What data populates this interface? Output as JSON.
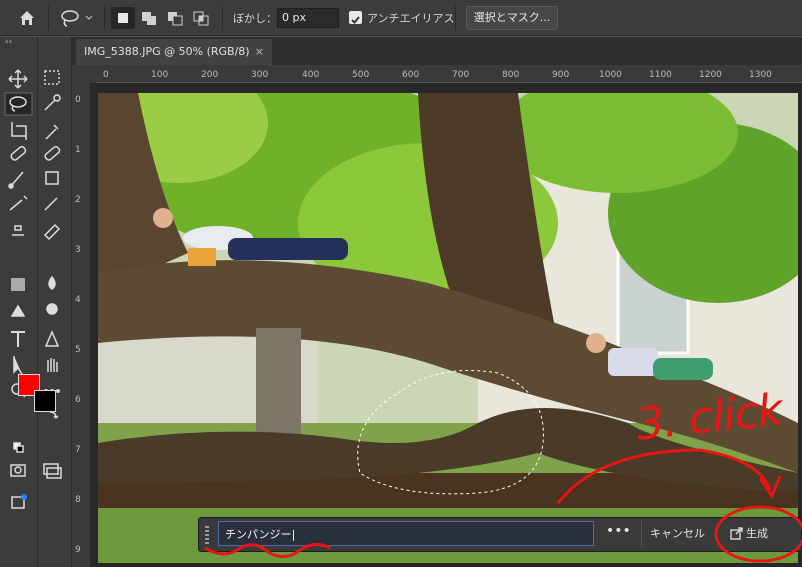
{
  "options_bar": {
    "blur_label": "ぼかし：",
    "blur_value": "0 px",
    "antialias_label": "アンチエイリアス",
    "select_mask_label": "選択とマスク..."
  },
  "document": {
    "tab_title": "IMG_5388.JPG @ 50% (RGB/8)",
    "close_symbol": "×"
  },
  "ruler": {
    "h_ticks": [
      "0",
      "100",
      "200",
      "300",
      "400",
      "500",
      "600",
      "700",
      "800",
      "900",
      "1000",
      "1100",
      "1200",
      "1300"
    ],
    "v_ticks": [
      "0",
      "1",
      "2",
      "3",
      "4",
      "5",
      "6",
      "7",
      "8",
      "9"
    ]
  },
  "colors": {
    "foreground": "#ff0000",
    "background": "#000000",
    "annotation": "#e81515"
  },
  "context_bar": {
    "prompt_value": "チンパンジー",
    "more_label": "•••",
    "cancel_label": "キャンセル",
    "generate_label": "生成"
  },
  "annotation": {
    "label": "3. click"
  },
  "icons": {
    "home": "home-icon",
    "lasso": "lasso-icon",
    "generate": "generate-icon"
  }
}
